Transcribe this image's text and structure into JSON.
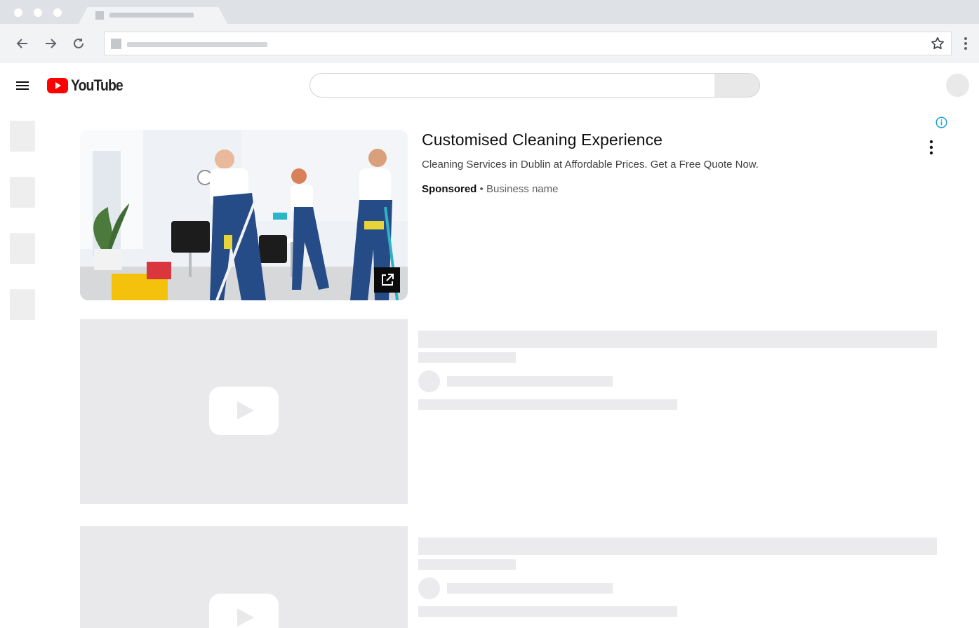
{
  "browser": {
    "icons": [
      "back-arrow-icon",
      "forward-arrow-icon",
      "reload-icon",
      "bookmark-star-icon",
      "chrome-menu-icon"
    ]
  },
  "header": {
    "logo_text": "YouTube",
    "brand_color": "#ff0000"
  },
  "ad": {
    "title": "Customised Cleaning Experience",
    "description": "Cleaning Services in Dublin at Affordable Prices. Get a Free Quote Now.",
    "sponsored_label": "Sponsored",
    "separator": " • ",
    "advertiser": "Business name",
    "info_color": "#1aa3d8"
  },
  "colors": {
    "skeleton": "#e9e9ec",
    "chrome_tabstrip": "#dee1e6",
    "chrome_toolbar": "#f1f3f4"
  }
}
